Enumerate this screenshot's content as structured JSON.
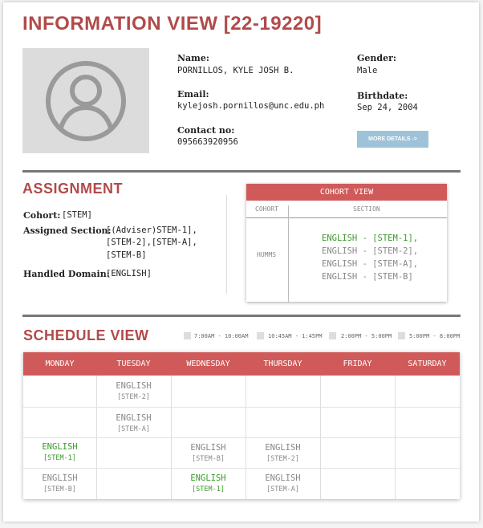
{
  "page": {
    "title": "INFORMATION VIEW [22-19220]"
  },
  "profile": {
    "name_label": "Name:",
    "name": "PORNILLOS, KYLE JOSH B.",
    "email_label": "Email:",
    "email": "kylejosh.pornillos@unc.edu.ph",
    "contact_label": "Contact no:",
    "contact": "095663920956",
    "gender_label": "Gender:",
    "gender": "Male",
    "birthdate_label": "Birthdate:",
    "birthdate": "Sep 24, 2004",
    "more_button": "MORE DETAILS ->"
  },
  "assignment": {
    "title": "ASSIGNMENT",
    "cohort_label": "Cohort:",
    "cohort": "[STEM]",
    "assigned_label": "Assigned Section:",
    "assigned_lines": [
      "[(Adviser)STEM-1],",
      "[STEM-2],[STEM-A],",
      "[STEM-B]"
    ],
    "domain_label": "Handled Domain:",
    "domain": "[ENGLISH]"
  },
  "cohort_view": {
    "title": "COHORT VIEW",
    "col_cohort": "COHORT",
    "col_section": "SECTION",
    "cohort": "HUMMS",
    "sections": [
      {
        "text": "ENGLISH - [STEM-1],",
        "color": "#3a9a2a"
      },
      {
        "text": "ENGLISH - [STEM-2],",
        "color": "#888888"
      },
      {
        "text": "ENGLISH - [STEM-A],",
        "color": "#888888"
      },
      {
        "text": "ENGLISH - [STEM-B]",
        "color": "#888888"
      }
    ]
  },
  "schedule": {
    "title": "SCHEDULE VIEW",
    "legend": [
      "7:00AM - 10:00AM",
      "10:45AM - 1:45PM",
      "2:00PM - 5:00PM",
      "5:00PM - 8:00PM"
    ],
    "days": [
      "MONDAY",
      "TUESDAY",
      "WEDNESDAY",
      "THURSDAY",
      "FRIDAY",
      "SATURDAY"
    ],
    "cells": {
      "tue_1": {
        "subject": "ENGLISH",
        "section": "[STEM-2]"
      },
      "tue_2": {
        "subject": "ENGLISH",
        "section": "[STEM-A]"
      },
      "mon_3": {
        "subject": "ENGLISH",
        "section": "[STEM-1]"
      },
      "wed_3": {
        "subject": "ENGLISH",
        "section": "[STEM-B]"
      },
      "thu_3": {
        "subject": "ENGLISH",
        "section": "[STEM-2]"
      },
      "mon_4": {
        "subject": "ENGLISH",
        "section": "[STEM-B]"
      },
      "wed_4": {
        "subject": "ENGLISH",
        "section": "[STEM-1]"
      },
      "thu_4": {
        "subject": "ENGLISH",
        "section": "[STEM-A]"
      }
    },
    "colors": {
      "header": "#d05a5a",
      "advisory": "#3a9a2a",
      "regular": "#888888"
    }
  }
}
